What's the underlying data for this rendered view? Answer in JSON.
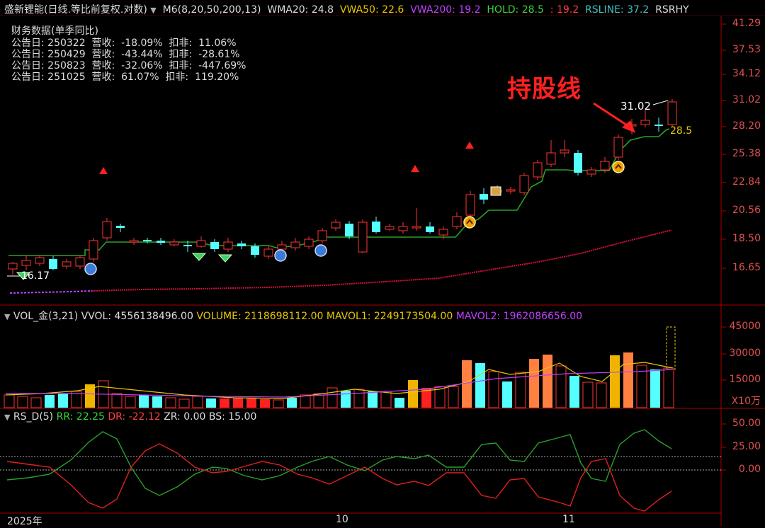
{
  "header": {
    "title": "盛新锂能(日线.等比前复权.对数)",
    "m6": "M6(8,20,50,200,13)",
    "wma20": "WMA20: 24.8",
    "vwa50": "VWA50: 22.6",
    "vwa200": "VWA200: 19.2",
    "hold": "HOLD: 28.5",
    "hold_extra": ": 19.2",
    "rsline": "RSLINE: 37.2",
    "rsrhy": "RSRHY"
  },
  "financial": {
    "title": "财务数据(单季同比)",
    "rows": [
      {
        "date": "公告日: 250322",
        "rev": "营收:  -18.09%",
        "deduct": "扣非:  11.06%"
      },
      {
        "date": "公告日: 250429",
        "rev": "营收:  -43.44%",
        "deduct": "扣非:  -28.61%"
      },
      {
        "date": "公告日: 250823",
        "rev": "营收:  -32.06%",
        "deduct": "扣非:  -447.69%"
      },
      {
        "date": "公告日: 251025",
        "rev": "营收:  61.07%",
        "deduct": "扣非:  119.20%"
      }
    ]
  },
  "annotations": {
    "hold_line_label": "持股线",
    "high_price": "31.02",
    "low_price": "16.17",
    "hold_value": "28.5"
  },
  "price_axis": [
    "41.29",
    "37.53",
    "34.12",
    "31.02",
    "28.20",
    "25.38",
    "22.84",
    "20.56",
    "18.50",
    "16.65"
  ],
  "volume": {
    "header": {
      "name": "VOL_金(3,21)",
      "vvol": "VVOL: 4556138496.00",
      "volume": "VOLUME: 2118698112.00",
      "mavol1": "MAVOL1: 2249173504.00",
      "mavol2": "MAVOL2: 1962086656.00"
    },
    "axis": [
      "45000",
      "30000",
      "15000"
    ],
    "unit": "X10万"
  },
  "rs": {
    "header": {
      "name": "RS_D(5)",
      "rr": "RR: 22.25",
      "dr": "DR: -22.12",
      "zr": "ZR: 0.00",
      "bs": "BS: 15.00"
    },
    "axis": [
      "50.00",
      "25.00",
      "0.00"
    ]
  },
  "time_axis": {
    "year": "2025年",
    "m10": "10",
    "m11": "11"
  },
  "colors": {
    "up": "#ff3333",
    "down": "#55ffff",
    "hold": "#2aa02a",
    "ma_red": "#d0103a",
    "yellow": "#e6c800",
    "magenta": "#c040ff",
    "orange": "#ff8040"
  }
}
